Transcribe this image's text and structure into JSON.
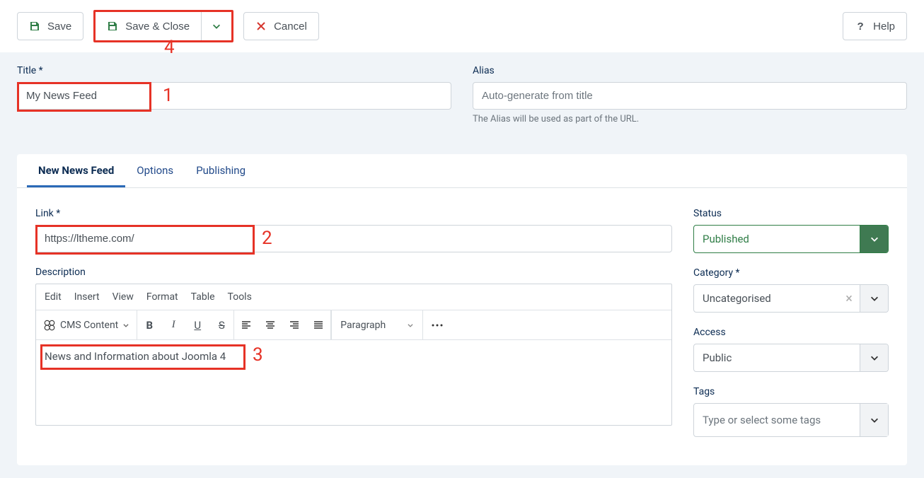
{
  "toolbar": {
    "save_label": "Save",
    "save_close_label": "Save & Close",
    "cancel_label": "Cancel",
    "help_label": "Help"
  },
  "annotations": {
    "one": "1",
    "two": "2",
    "three": "3",
    "four": "4"
  },
  "form": {
    "title_label": "Title *",
    "title_value": "My News Feed",
    "alias_label": "Alias",
    "alias_placeholder": "Auto-generate from title",
    "alias_hint": "The Alias will be used as part of the URL."
  },
  "tabs": {
    "new_feed": "New News Feed",
    "options": "Options",
    "publishing": "Publishing"
  },
  "main": {
    "link_label": "Link *",
    "link_value": "https://ltheme.com/",
    "desc_label": "Description",
    "desc_value": "News and Information about Joomla 4",
    "editor_menu": {
      "edit": "Edit",
      "insert": "Insert",
      "view": "View",
      "format": "Format",
      "table": "Table",
      "tools": "Tools"
    },
    "cms_content_label": "CMS Content",
    "paragraph_label": "Paragraph"
  },
  "side": {
    "status_label": "Status",
    "status_value": "Published",
    "category_label": "Category *",
    "category_value": "Uncategorised",
    "access_label": "Access",
    "access_value": "Public",
    "tags_label": "Tags",
    "tags_placeholder": "Type or select some tags"
  }
}
